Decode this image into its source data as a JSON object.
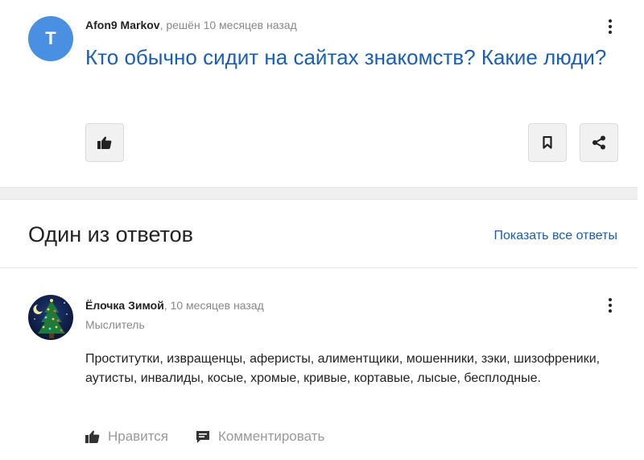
{
  "question": {
    "avatar_letter": "T",
    "author": "Afon9 Markov",
    "meta_suffix": ", решён 10 месяцев назад",
    "title": "Кто обычно сидит на сайтах знакомств? Какие люди?"
  },
  "answers_section": {
    "title": "Один из ответов",
    "show_all": "Показать все ответы"
  },
  "answer": {
    "author": "Ёлочка Зимой",
    "meta_suffix": ", 10 месяцев назад",
    "rank": "Мыслитель",
    "text": "Проститутки, извращенцы, аферисты, алиментщики, мошенники, зэки, шизофреники, аутисты, инвалиды, косые, хромые, кривые, кортавые, лысые, бесплодные.",
    "like_label": "Нравится",
    "comment_label": "Комментировать"
  },
  "icons": {
    "like": "thumb-up-icon",
    "bookmark": "bookmark-icon",
    "share": "share-icon",
    "menu": "more-vertical-icon",
    "comment": "comment-icon"
  },
  "colors": {
    "accent": "#1a5fb4",
    "avatar_bg": "#4a90e2",
    "muted": "#888888",
    "button_bg": "#f1f1f1"
  }
}
